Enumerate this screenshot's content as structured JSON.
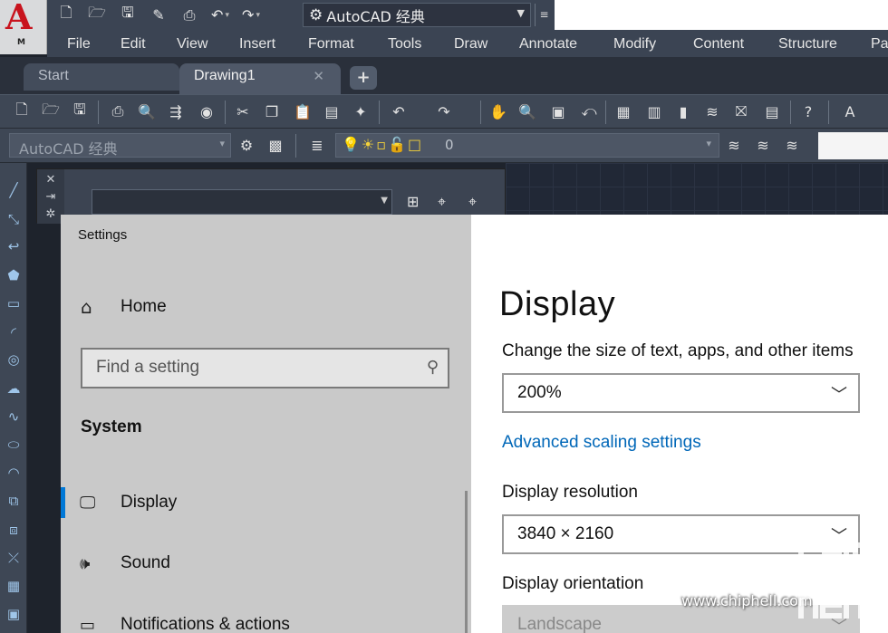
{
  "app": {
    "logo_letter": "A",
    "logo_sub": "M",
    "workspace_combo": "AutoCAD 经典",
    "menu": [
      "File",
      "Edit",
      "View",
      "Insert",
      "Format",
      "Tools",
      "Draw",
      "Annotate",
      "Modify",
      "Content",
      "Structure",
      "Pa"
    ],
    "tabs": [
      {
        "label": "Start"
      },
      {
        "label": "Drawing1",
        "close": "✕"
      }
    ],
    "tab_add": "+",
    "workspace2": "AutoCAD 经典",
    "layer_name": "0"
  },
  "settings": {
    "window_title": "Settings",
    "home_label": "Home",
    "search_placeholder": "Find a setting",
    "section_heading": "System",
    "nav": [
      {
        "label": "Display",
        "icon": "monitor-icon",
        "selected": true
      },
      {
        "label": "Sound",
        "icon": "speaker-icon",
        "selected": false
      },
      {
        "label": "Notifications & actions",
        "icon": "notification-icon",
        "selected": false
      }
    ],
    "page_title": "Display",
    "scale_label": "Change the size of text, apps, and other items",
    "scale_value": "200%",
    "advanced_link": "Advanced scaling settings",
    "resolution_label": "Display resolution",
    "resolution_value": "3840 × 2160",
    "orientation_label": "Display orientation",
    "orientation_value": "Landscape"
  },
  "watermark": {
    "url": "www.chiphell.com",
    "logo_text": "chip hell"
  },
  "colors": {
    "accent": "#0078d7",
    "link": "#0067b8",
    "autocad_red": "#c8141e"
  }
}
